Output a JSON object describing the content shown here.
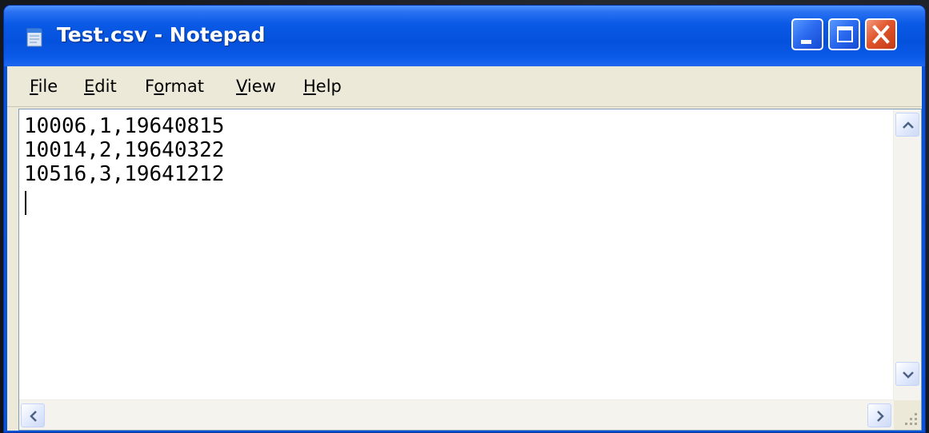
{
  "window": {
    "title": "Test.csv - Notepad"
  },
  "menu": {
    "items": [
      {
        "label": "File",
        "mnemonic": "F",
        "rest": "ile"
      },
      {
        "label": "Edit",
        "mnemonic": "E",
        "rest": "dit"
      },
      {
        "label": "Format",
        "pre": "F",
        "mnemonic": "o",
        "rest": "rmat"
      },
      {
        "label": "View",
        "mnemonic": "V",
        "rest": "iew"
      },
      {
        "label": "Help",
        "mnemonic": "H",
        "rest": "elp"
      }
    ]
  },
  "editor": {
    "lines": [
      "10006,1,19640815",
      "10014,2,19640322",
      "10516,3,19641212"
    ]
  },
  "icons": {
    "app": "notepad-icon",
    "minimize": "minimize-icon",
    "maximize": "maximize-icon",
    "close": "close-icon",
    "scroll_up": "chevron-up-icon",
    "scroll_down": "chevron-down-icon",
    "scroll_left": "chevron-left-icon",
    "scroll_right": "chevron-right-icon",
    "resize": "resize-grip-icon"
  },
  "colors": {
    "titlebar": "#0451dc",
    "close_button": "#e0552c",
    "menubar": "#ece9d8",
    "editor_bg": "#ffffff"
  }
}
